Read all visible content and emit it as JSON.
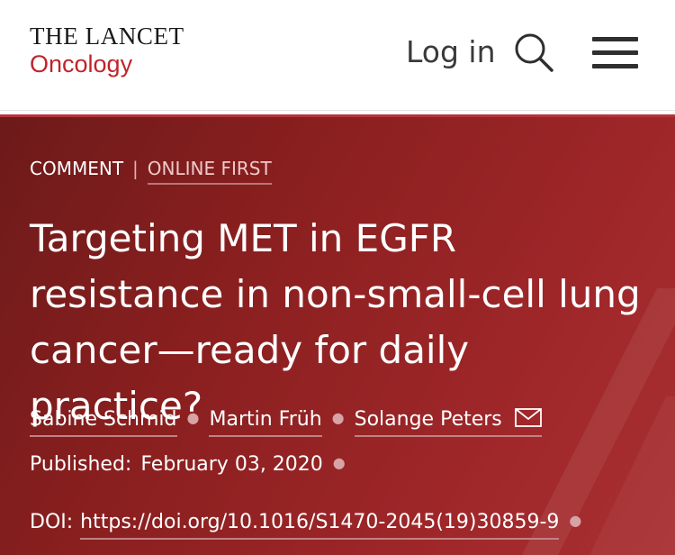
{
  "header": {
    "journal_name": "THE LANCET",
    "journal_sub": "Oncology",
    "login_label": "Log in"
  },
  "article": {
    "type": "COMMENT",
    "status": "ONLINE FIRST",
    "title": "Targeting MET in EGFR resistance in non-small-cell lung cancer—ready for daily practice?",
    "authors": [
      "Sabine Schmid",
      "Martin Früh",
      "Solange Peters"
    ],
    "published_label": "Published:",
    "published_date": "February 03, 2020",
    "doi_label": "DOI:",
    "doi_link": "https://doi.org/10.1016/S1470-2045(19)30859-9"
  },
  "icons": {
    "search": "search-icon",
    "menu": "hamburger-menu-icon",
    "mail": "mail-icon"
  },
  "colors": {
    "brand_red": "#c0242a",
    "hero_background": "#8a1f1f",
    "text_dark": "#3a3a3a"
  }
}
